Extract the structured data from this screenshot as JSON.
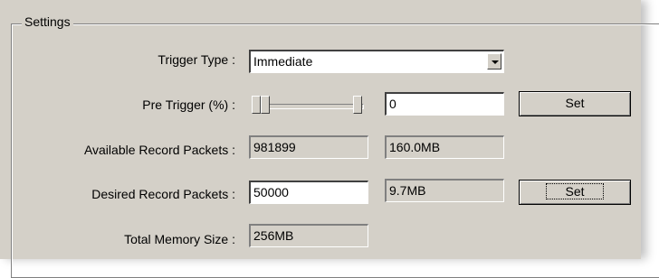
{
  "group": {
    "title": "Settings"
  },
  "trigger_type": {
    "label": "Trigger Type :",
    "value": "Immediate"
  },
  "pre_trigger": {
    "label": "Pre Trigger (%) :",
    "value": "0",
    "set_label": "Set",
    "slider_position": 0
  },
  "available_packets": {
    "label": "Available Record Packets :",
    "value": "981899",
    "size": "160.0MB"
  },
  "desired_packets": {
    "label": "Desired Record Packets :",
    "value": "50000",
    "size": "9.7MB",
    "set_label": "Set"
  },
  "total_memory": {
    "label": "Total Memory Size :",
    "value": "256MB"
  }
}
